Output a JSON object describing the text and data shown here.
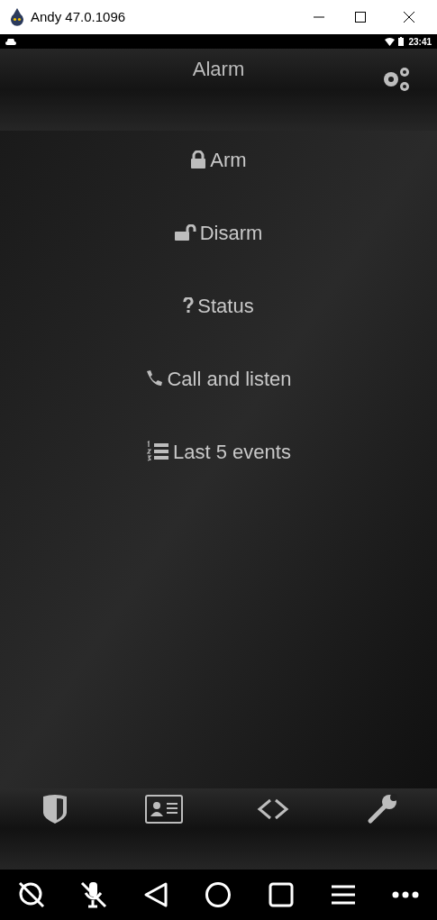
{
  "window": {
    "title": "Andy 47.0.1096"
  },
  "status_bar": {
    "time": "23:41"
  },
  "header": {
    "title": "Alarm"
  },
  "menu": [
    {
      "kind": "lock",
      "label": "Arm"
    },
    {
      "kind": "unlock",
      "label": "Disarm"
    },
    {
      "kind": "question",
      "label": "Status"
    },
    {
      "kind": "phone",
      "label": "Call and listen"
    },
    {
      "kind": "list",
      "label": "Last 5 events"
    }
  ]
}
